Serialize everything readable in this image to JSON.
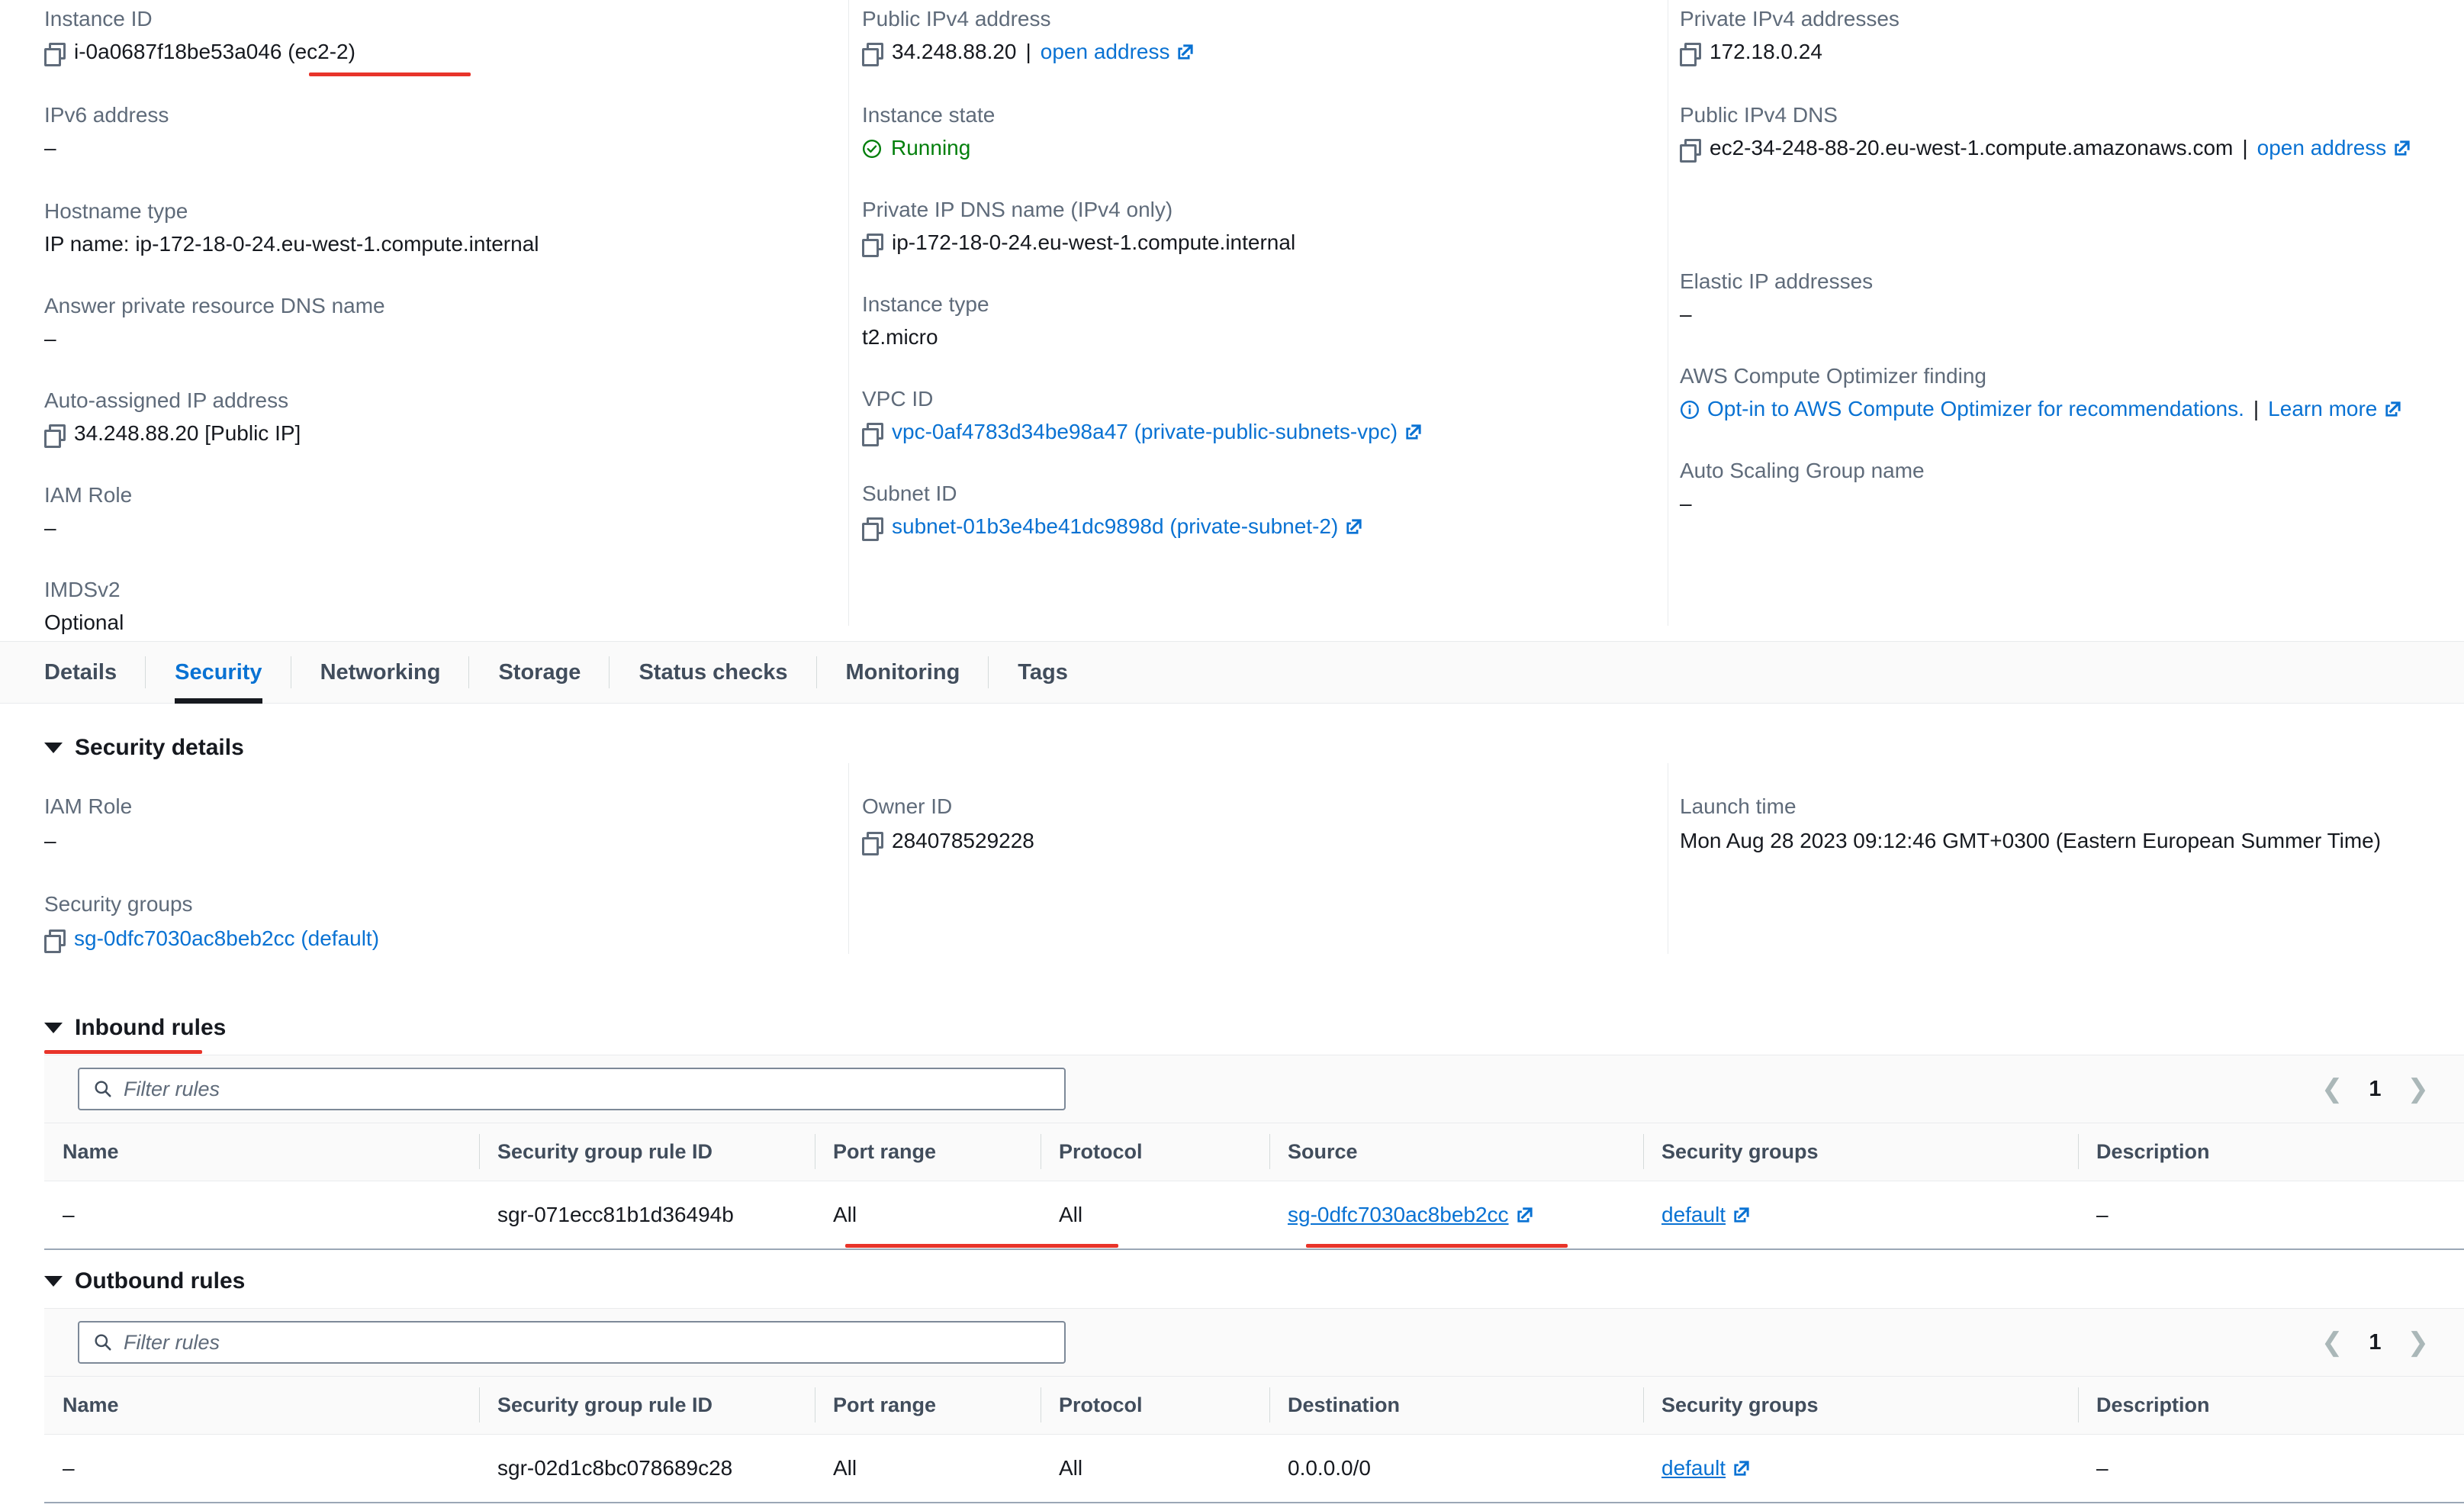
{
  "overview": {
    "col1": [
      {
        "label": "Instance ID",
        "value": "i-0a0687f18be53a046 (ec2-2)",
        "copy": true
      },
      {
        "label": "IPv6 address",
        "value": "–",
        "copy": false
      },
      {
        "label": "Hostname type",
        "value": "IP name: ip-172-18-0-24.eu-west-1.compute.internal",
        "copy": false
      },
      {
        "label": "Answer private resource DNS name",
        "value": "–",
        "copy": false
      },
      {
        "label": "Auto-assigned IP address",
        "value": "34.248.88.20 [Public IP]",
        "copy": true
      },
      {
        "label": "IAM Role",
        "value": "–",
        "copy": false
      },
      {
        "label": "IMDSv2",
        "value": "Optional",
        "copy": false
      }
    ],
    "col2": [
      {
        "label": "Public IPv4 address",
        "value": "34.248.88.20",
        "copy": true,
        "sep": "|",
        "link": "open address",
        "ext": true
      },
      {
        "label": "Instance state",
        "value": "Running",
        "state": true
      },
      {
        "label": "Private IP DNS name (IPv4 only)",
        "value": "ip-172-18-0-24.eu-west-1.compute.internal",
        "copy": true
      },
      {
        "label": "Instance type",
        "value": "t2.micro",
        "copy": false
      },
      {
        "label": "VPC ID",
        "value": "vpc-0af4783d34be98a47 (private-public-subnets-vpc)",
        "copy": true,
        "is_link": true,
        "ext": true
      },
      {
        "label": "Subnet ID",
        "value": "subnet-01b3e4be41dc9898d (private-subnet-2)",
        "copy": true,
        "is_link": true,
        "ext": true
      }
    ],
    "col3": [
      {
        "label": "Private IPv4 addresses",
        "value": "172.18.0.24",
        "copy": true
      },
      {
        "label": "Public IPv4 DNS",
        "value": "ec2-34-248-88-20.eu-west-1.compute.amazonaws.com",
        "copy": true,
        "sep": "|",
        "link": "open address",
        "ext": true
      },
      {
        "label": "Elastic IP addresses",
        "value": "–",
        "copy": false
      },
      {
        "label": "AWS Compute Optimizer finding",
        "value": "Opt-in to AWS Compute Optimizer for recommendations.",
        "info": true,
        "is_link": true,
        "sep": "|",
        "link": "Learn more",
        "ext": true
      },
      {
        "label": "Auto Scaling Group name",
        "value": "–",
        "copy": false
      }
    ]
  },
  "tabs": [
    {
      "label": "Details",
      "active": false
    },
    {
      "label": "Security",
      "active": true
    },
    {
      "label": "Networking",
      "active": false
    },
    {
      "label": "Storage",
      "active": false
    },
    {
      "label": "Status checks",
      "active": false
    },
    {
      "label": "Monitoring",
      "active": false
    },
    {
      "label": "Tags",
      "active": false
    }
  ],
  "security_details": {
    "title": "Security details",
    "iam_role_label": "IAM Role",
    "iam_role_value": "–",
    "security_groups_label": "Security groups",
    "security_groups_value": "sg-0dfc7030ac8beb2cc (default)",
    "owner_id_label": "Owner ID",
    "owner_id_value": "284078529228",
    "launch_time_label": "Launch time",
    "launch_time_value": "Mon Aug 28 2023 09:12:46 GMT+0300 (Eastern European Summer Time)"
  },
  "inbound_rules": {
    "title": "Inbound rules",
    "filter_placeholder": "Filter rules",
    "page": "1",
    "columns": [
      "Name",
      "Security group rule ID",
      "Port range",
      "Protocol",
      "Source",
      "Security groups",
      "Description"
    ],
    "rows": [
      {
        "name": "–",
        "rule_id": "sgr-071ecc81b1d36494b",
        "port_range": "All",
        "protocol": "All",
        "source": "sg-0dfc7030ac8beb2cc",
        "security_groups": "default",
        "description": "–"
      }
    ]
  },
  "outbound_rules": {
    "title": "Outbound rules",
    "filter_placeholder": "Filter rules",
    "page": "1",
    "columns": [
      "Name",
      "Security group rule ID",
      "Port range",
      "Protocol",
      "Destination",
      "Security groups",
      "Description"
    ],
    "rows": [
      {
        "name": "–",
        "rule_id": "sgr-02d1c8bc078689c28",
        "port_range": "All",
        "protocol": "All",
        "destination": "0.0.0.0/0",
        "security_groups": "default",
        "description": "–"
      }
    ]
  },
  "colors": {
    "link": "#0972d3",
    "running": "#037f0c",
    "annotation": "#e8342a",
    "active_tab_underline": "#16191f"
  }
}
